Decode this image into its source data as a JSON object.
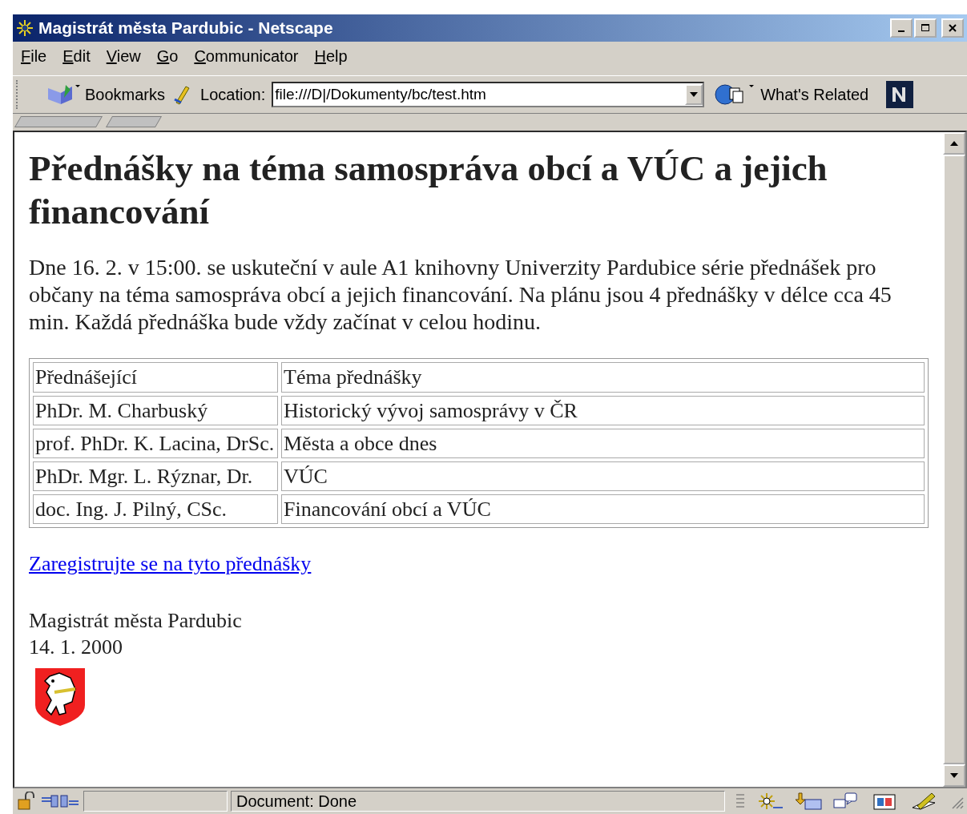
{
  "window": {
    "title": "Magistrát města Pardubic - Netscape"
  },
  "menu": [
    "File",
    "Edit",
    "View",
    "Go",
    "Communicator",
    "Help"
  ],
  "toolbar": {
    "bookmarks": "Bookmarks",
    "location_label": "Location:",
    "location_value": "file:///D|/Dokumenty/bc/test.htm",
    "related": "What's Related"
  },
  "page": {
    "heading": "Přednášky na téma samospráva obcí a VÚC a jejich financování",
    "intro": "Dne 16. 2. v 15:00. se uskuteční v aule A1 knihovny Univerzity Pardubice série přednášek pro občany na téma samospráva obcí a jejich financování. Na plánu jsou 4 přednášky v délce cca 45 min. Každá přednáška bude vždy začínat v celou hodinu.",
    "table": {
      "columns": [
        "Přednášející",
        "Téma přednášky"
      ],
      "rows": [
        [
          "PhDr. M. Charbuský",
          "Historický vývoj samosprávy v ČR"
        ],
        [
          "prof. PhDr. K. Lacina, DrSc.",
          "Města a obce dnes"
        ],
        [
          "PhDr. Mgr. L. Rýznar, Dr.",
          "VÚC"
        ],
        [
          "doc. Ing. J. Pilný, CSc.",
          "Financování obcí a VÚC"
        ]
      ]
    },
    "link": "Zaregistrujte se na tyto přednášky",
    "signature": "Magistrát města Pardubic",
    "date": "14. 1. 2000"
  },
  "status_bar": {
    "text": "Document: Done"
  }
}
